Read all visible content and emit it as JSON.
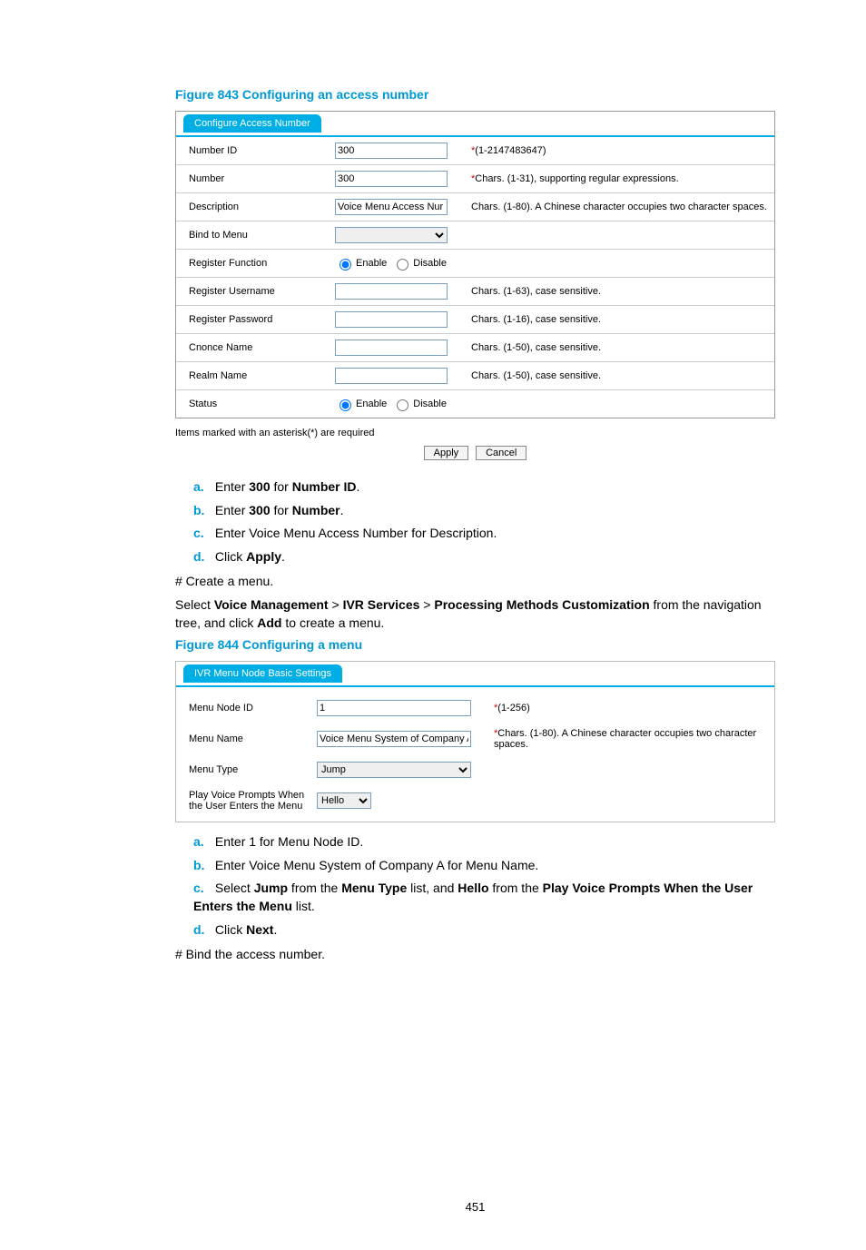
{
  "figure843": {
    "caption": "Figure 843 Configuring an access number",
    "tab": "Configure Access Number",
    "rows": {
      "number_id": {
        "label": "Number ID",
        "value": "300",
        "hint": "(1-2147483647)"
      },
      "number": {
        "label": "Number",
        "value": "300",
        "hint": "Chars. (1-31), supporting regular expressions."
      },
      "description": {
        "label": "Description",
        "value": "Voice Menu Access Nur",
        "hint": "Chars. (1-80). A Chinese character occupies two character spaces."
      },
      "bind_to_menu": {
        "label": "Bind to Menu",
        "value": ""
      },
      "register_function": {
        "label": "Register Function",
        "enable": "Enable",
        "disable": "Disable"
      },
      "register_username": {
        "label": "Register Username",
        "value": "",
        "hint": "Chars. (1-63), case sensitive."
      },
      "register_password": {
        "label": "Register Password",
        "value": "",
        "hint": "Chars. (1-16), case sensitive."
      },
      "cnonce_name": {
        "label": "Cnonce Name",
        "value": "",
        "hint": "Chars. (1-50), case sensitive."
      },
      "realm_name": {
        "label": "Realm Name",
        "value": "",
        "hint": "Chars. (1-50), case sensitive."
      },
      "status": {
        "label": "Status",
        "enable": "Enable",
        "disable": "Disable"
      }
    },
    "footnote": "Items marked with an asterisk(*) are required",
    "apply": "Apply",
    "cancel": "Cancel"
  },
  "steps843": {
    "a_pre": "Enter ",
    "a_bold1": "300",
    "a_mid": " for ",
    "a_bold2": "Number ID",
    "a_post": ".",
    "b_pre": "Enter ",
    "b_bold1": "300",
    "b_mid": " for ",
    "b_bold2": "Number",
    "b_post": ".",
    "c": "Enter Voice Menu Access Number for Description.",
    "d_pre": "Click ",
    "d_bold": "Apply",
    "d_post": "."
  },
  "mid": {
    "create_menu": "# Create a menu.",
    "select_pre": "Select ",
    "vm": "Voice Management",
    "gt1": " > ",
    "ivr": "IVR Services",
    "gt2": " > ",
    "pmc": "Processing Methods Customization",
    "select_mid": " from the navigation tree, and click ",
    "add": "Add",
    "select_post": " to create a menu."
  },
  "figure844": {
    "caption": "Figure 844 Configuring a menu",
    "tab": "IVR Menu Node Basic Settings",
    "rows": {
      "menu_node_id": {
        "label": "Menu Node ID",
        "value": "1",
        "hint": "(1-256)"
      },
      "menu_name": {
        "label": "Menu Name",
        "value": "Voice Menu System of Company A",
        "hint": "Chars. (1-80). A Chinese character occupies two character spaces."
      },
      "menu_type": {
        "label": "Menu Type",
        "value": "Jump"
      },
      "play_prompts": {
        "label": "Play Voice Prompts When the User Enters the Menu",
        "value": "Hello"
      }
    }
  },
  "steps844": {
    "a": "Enter 1 for Menu Node ID.",
    "b": "Enter Voice Menu System of Company A for Menu Name.",
    "c_pre": "Select ",
    "c_b1": "Jump",
    "c_m1": " from the ",
    "c_b2": "Menu Type",
    "c_m2": " list, and ",
    "c_b3": "Hello",
    "c_m3": " from the ",
    "c_b4": "Play Voice Prompts When the User Enters the Menu",
    "c_post": " list.",
    "d_pre": "Click ",
    "d_bold": "Next",
    "d_post": "."
  },
  "tail": {
    "bind": "# Bind the access number."
  },
  "markers": {
    "a": "a.",
    "b": "b.",
    "c": "c.",
    "d": "d."
  },
  "star": "*",
  "page_number": "451"
}
